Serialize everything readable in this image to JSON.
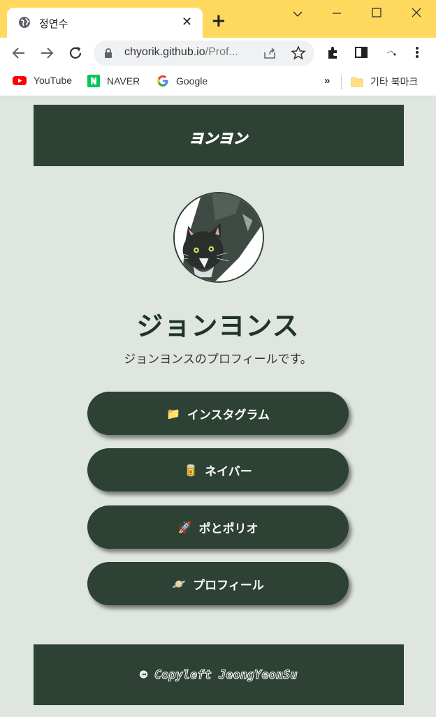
{
  "browser": {
    "tab_title": "정연수",
    "url_host": "chyorik.github.io",
    "url_path": "/Prof...",
    "bookmarks": [
      {
        "label": "YouTube",
        "icon": "youtube-icon"
      },
      {
        "label": "NAVER",
        "icon": "naver-icon"
      },
      {
        "label": "Google",
        "icon": "google-icon"
      }
    ],
    "overflow": "»",
    "other_bookmarks": "기타 북마크"
  },
  "page": {
    "header_title": "ヨンヨン",
    "avatar_icon": "cat-avatar",
    "name": "ジョンヨンス",
    "description": "ジョンヨンスのプロフィールです。",
    "links": [
      {
        "label": "インスタグラム",
        "icon": "📁"
      },
      {
        "label": "ネイバー",
        "icon": "🥫"
      },
      {
        "label": "ポとポリオ",
        "icon": "🚀"
      },
      {
        "label": "プロフィール",
        "icon": "🪐"
      }
    ],
    "footer": "© Copyleft JeongYeonSu"
  },
  "colors": {
    "brand_dark": "#2d4235",
    "background": "#dfe5df",
    "tab_bar": "#ffd95e"
  }
}
